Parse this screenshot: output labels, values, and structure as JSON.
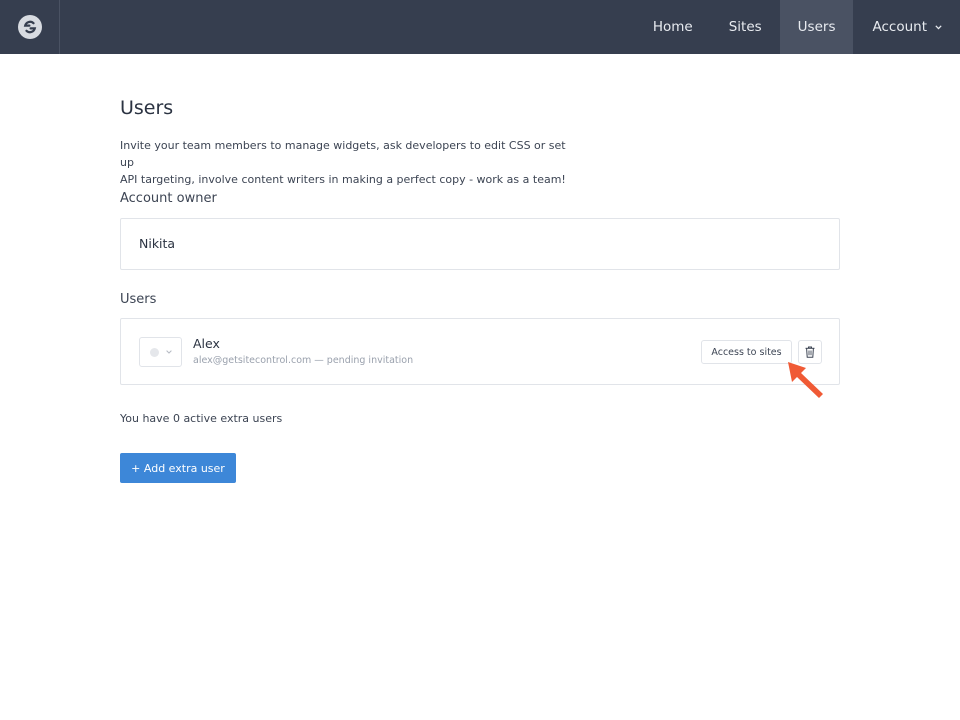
{
  "colors": {
    "topbar": "#363e4f",
    "active_nav": "#4a5263",
    "primary_button": "#3d87d8",
    "annotation_arrow": "#f05a35"
  },
  "header": {
    "logo_icon": "brand-logo-icon",
    "nav": {
      "home": "Home",
      "sites": "Sites",
      "users": "Users",
      "account": "Account"
    },
    "active_item": "Users"
  },
  "main": {
    "title": "Users",
    "intro_line1": "Invite your team members to manage widgets, ask developers to edit CSS or set up",
    "intro_line2": "API targeting, involve content writers in making a perfect copy - work as a team!",
    "owner_section_label": "Account owner",
    "owner_name": "Nikita",
    "users_section_label": "Users",
    "users": [
      {
        "name": "Alex",
        "meta": "alex@getsitecontrol.com — pending invitation",
        "access_button": "Access to sites",
        "delete_icon": "trash-icon"
      }
    ],
    "active_count_text": "You have 0 active extra users",
    "add_button": "+ Add extra user"
  }
}
